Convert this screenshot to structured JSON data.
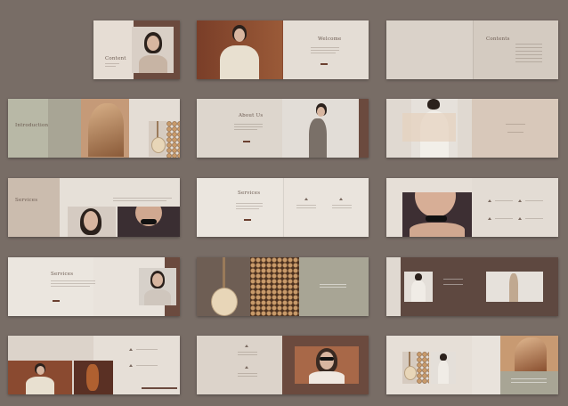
{
  "spreads": {
    "cover": {
      "title": "Content"
    },
    "welcome": {
      "title": "Welcome"
    },
    "contents": {
      "title": "Contents"
    },
    "introduction": {
      "title": "Introduction"
    },
    "about": {
      "title": "About Us"
    },
    "services_a": {
      "title": "Services"
    },
    "services_b": {
      "title": "Services"
    },
    "services_c": {
      "title": "Services"
    }
  },
  "colors": {
    "background": "#786d66",
    "paper_light": "#e9e3dc",
    "paper_beige": "#d6cbc0",
    "sage": "#a8a595",
    "brown": "#6b4a3e"
  }
}
